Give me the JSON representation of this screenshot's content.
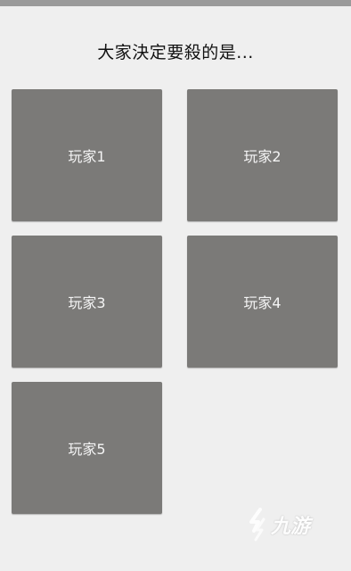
{
  "title": "大家決定要殺的是...",
  "players": [
    {
      "label": "玩家1"
    },
    {
      "label": "玩家2"
    },
    {
      "label": "玩家3"
    },
    {
      "label": "玩家4"
    },
    {
      "label": "玩家5"
    }
  ],
  "watermark": {
    "text": "九游",
    "icon": "jiuyou-logo-icon"
  },
  "colors": {
    "background": "#efefef",
    "card": "#7b7a78",
    "card_text": "#f4f4f4",
    "title_text": "#111111",
    "top_bar": "#9a9a9a"
  }
}
